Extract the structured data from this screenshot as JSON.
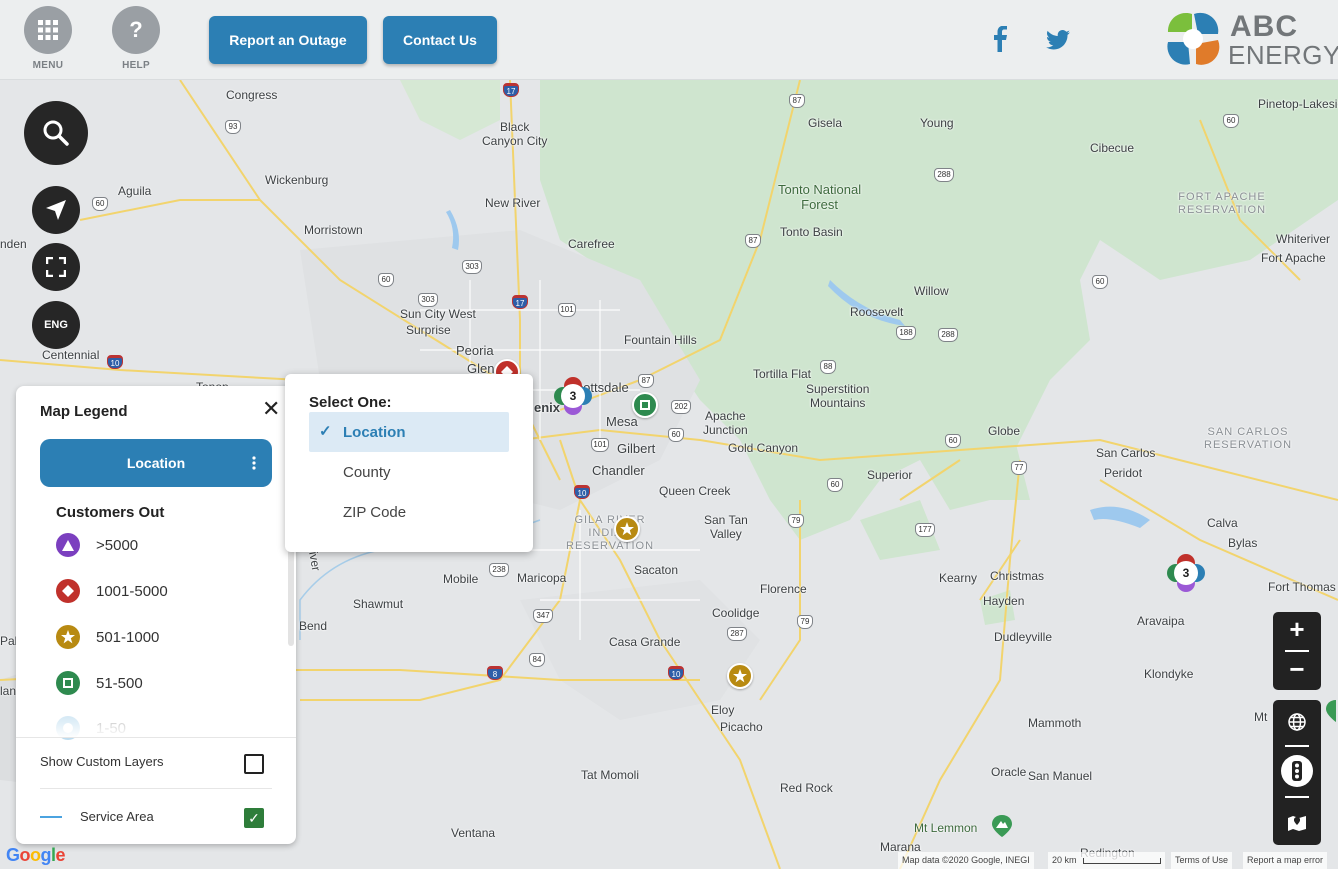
{
  "header": {
    "menu_label": "MENU",
    "help_label": "HELP",
    "help_glyph": "?",
    "report_button": "Report an Outage",
    "contact_button": "Contact Us",
    "logo_line1": "ABC",
    "logo_line2": "ENERGY",
    "brand_colors": [
      "#2c7fb4",
      "#e07b2a",
      "#7bbf3c",
      "#727679"
    ]
  },
  "map_controls": {
    "language": "ENG",
    "search_icon": "search-icon",
    "locate_icon": "navigation-arrow-icon",
    "fullscreen_icon": "fullscreen-icon"
  },
  "places": {
    "congress": "Congress",
    "black_canyon": "Black\nCanyon City",
    "gisela": "Gisela",
    "young": "Young",
    "pinetop": "Pinetop-Lakeside",
    "cibecue": "Cibecue",
    "wickenburg": "Wickenburg",
    "aguila": "Aguila",
    "tonto_forest": "Tonto National\nForest",
    "fort_apache_res": "FORT APACHE\nRESERVATION",
    "new_river": "New River",
    "morristown": "Morristown",
    "carefree": "Carefree",
    "tonto_basin": "Tonto Basin",
    "whiteriver": "Whiteriver",
    "fort_apache": "Fort Apache",
    "wenden": "nden",
    "sun_city_west": "Sun City West",
    "surprise": "Surprise",
    "willow": "Willow",
    "roosevelt": "Roosevelt",
    "fountain_hills": "Fountain Hills",
    "peoria": "Peoria",
    "centennial": "Centennial",
    "tortilla_flat": "Tortilla Flat",
    "superstition": "Superstition\nMountains",
    "glendale": "Glen",
    "scottsdale": "Scottsdale",
    "phoenix": "enix",
    "mesa": "Mesa",
    "apache_junction": "Apache\nJunction",
    "globe": "Globe",
    "san_carlos_res": "SAN CARLOS\nRESERVATION",
    "gilbert": "Gilbert",
    "gold_canyon": "Gold Canyon",
    "san_carlos": "San Carlos",
    "peridot": "Peridot",
    "chandler": "Chandler",
    "superior": "Superior",
    "queen_creek": "Queen Creek",
    "gila_res": "GILA RIVER\nINDIAN\nRESERVATION",
    "san_tan": "San Tan\nValley",
    "calva": "Calva",
    "bylas": "Bylas",
    "sacaton": "Sacaton",
    "kearny": "Kearny",
    "christmas": "Christmas",
    "mobile": "Mobile",
    "maricopa": "Maricopa",
    "shawmut": "Shawmut",
    "florence": "Florence",
    "hayden": "Hayden",
    "fort_thomas": "Fort Thomas",
    "aravaipa": "Aravaipa",
    "coolidge": "Coolidge",
    "bend": "Bend",
    "dudleyville": "Dudleyville",
    "casa_grande": "Casa Grande",
    "klondyke": "Klondyke",
    "eloy": "Eloy",
    "picacho": "Picacho",
    "mammoth": "Mammoth",
    "mt": "Mt",
    "tat_momoli": "Tat Momoli",
    "oracle": "Oracle",
    "san_manuel": "San Manuel",
    "red_rock": "Red Rock",
    "mt_lemmon": "Mt Lemmon",
    "ventana": "Ventana",
    "marana": "Marana",
    "redington": "Redington",
    "gila_bend_river": "River",
    "pal": "Pal",
    "lan": "lan",
    "tonopah": "Tonop"
  },
  "highways": [
    "17",
    "87",
    "60",
    "93",
    "288",
    "303",
    "60",
    "17",
    "101",
    "87",
    "202",
    "60",
    "101",
    "188",
    "288",
    "88",
    "60",
    "77",
    "10",
    "60",
    "79",
    "177",
    "238",
    "347",
    "84",
    "287",
    "79",
    "77",
    "8",
    "10",
    "10",
    "77",
    "60"
  ],
  "clusters": [
    {
      "count": "3"
    },
    {
      "count": "3"
    }
  ],
  "legend": {
    "title": "Map Legend",
    "close_glyph": "✕",
    "location_button": "Location",
    "customers_out_title": "Customers Out",
    "items": [
      {
        "label": ">5000",
        "color": "#7b3fbf",
        "icon": "triangle-icon"
      },
      {
        "label": "1001-5000",
        "color": "#c0312b",
        "icon": "diamond-icon"
      },
      {
        "label": "501-1000",
        "color": "#b88a12",
        "icon": "star-icon"
      },
      {
        "label": "51-500",
        "color": "#2e8a4f",
        "icon": "square-icon"
      },
      {
        "label": "1-50",
        "color": "#6fb3dd",
        "icon": "circle-icon"
      }
    ],
    "show_custom_layers": "Show Custom Layers",
    "service_area": "Service Area",
    "service_area_color": "#4ba3e0"
  },
  "dropdown": {
    "heading": "Select One:",
    "options": [
      "Location",
      "County",
      "ZIP Code"
    ],
    "selected": "Location"
  },
  "zoom": {
    "in": "+",
    "out": "−"
  },
  "footer": {
    "google": "Google",
    "map_data": "Map data ©2020 Google, INEGI",
    "scale": "20 km",
    "terms": "Terms of Use",
    "report_error": "Report a map error"
  }
}
